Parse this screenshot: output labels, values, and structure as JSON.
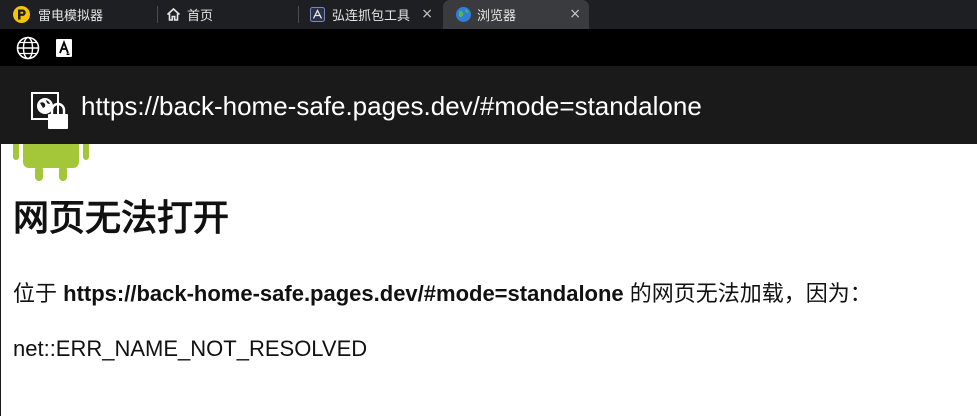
{
  "tabs": [
    {
      "label": "雷电模拟器",
      "icon": "ldplayer-logo-icon",
      "active": false,
      "closable": false
    },
    {
      "label": "首页",
      "icon": "home-icon",
      "active": false,
      "closable": false
    },
    {
      "label": "弘连抓包工具",
      "icon": "capture-tool-icon",
      "active": false,
      "closable": true
    },
    {
      "label": "浏览器",
      "icon": "browser-globe-icon",
      "active": true,
      "closable": true
    }
  ],
  "tab_close_glyph": "×",
  "statusbar": {
    "icons": [
      "globe-icon",
      "font-notification-icon"
    ]
  },
  "address": {
    "url": "https://back-home-safe.pages.dev/#mode=standalone",
    "icon": "insecure-site-lock-icon"
  },
  "error_page": {
    "title": "网页无法打开",
    "message_prefix": "位于 ",
    "message_url": "https://back-home-safe.pages.dev/#mode=standalone",
    "message_suffix": " 的网页无法加载，因为：",
    "error_code": "net::ERR_NAME_NOT_RESOLVED"
  },
  "colors": {
    "tabbar_bg": "#1e1f22",
    "active_tab_bg": "#3a3b3f",
    "address_bg": "#1a1a1a",
    "ldplayer_yellow": "#f5c400",
    "android_green": "#a4c639"
  }
}
